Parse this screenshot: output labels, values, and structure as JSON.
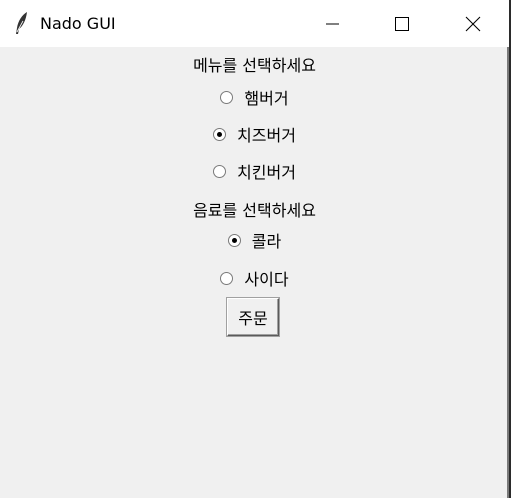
{
  "window": {
    "title": "Nado GUI"
  },
  "menu_section": {
    "label": "메뉴를 선택하세요",
    "options": [
      {
        "label": "햄버거",
        "selected": false
      },
      {
        "label": "치즈버거",
        "selected": true
      },
      {
        "label": "치킨버거",
        "selected": false
      }
    ]
  },
  "drink_section": {
    "label": "음료를 선택하세요",
    "options": [
      {
        "label": "콜라",
        "selected": true
      },
      {
        "label": "사이다",
        "selected": false
      }
    ]
  },
  "order_button": {
    "label": "주문"
  },
  "icons": {
    "app": "feather-icon",
    "minimize": "minimize-icon",
    "maximize": "maximize-icon",
    "close": "close-icon"
  }
}
